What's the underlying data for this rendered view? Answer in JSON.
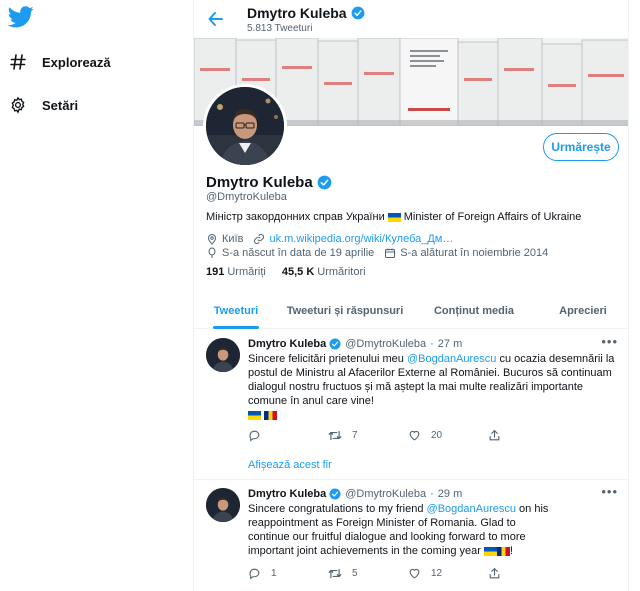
{
  "nav": {
    "logo_icon": "twitter-bird-icon",
    "items": [
      {
        "label": "Explorează",
        "icon": "hashtag-icon"
      },
      {
        "label": "Setări",
        "icon": "gear-icon"
      }
    ]
  },
  "header": {
    "name": "Dmytro Kuleba",
    "tweet_count": "5.813 Tweeturi"
  },
  "profile": {
    "name": "Dmytro Kuleba",
    "handle": "@DmytroKuleba",
    "follow_label": "Urmărește",
    "bio_before": "Міністр закордонних справ України",
    "bio_after": "Minister of Foreign Affairs of Ukraine",
    "location": "Київ",
    "website": "uk.m.wikipedia.org/wiki/Кулеба_Дм…",
    "born": "S-a născut în data de 19 aprilie",
    "joined": "S-a alăturat în noiembrie 2014",
    "following_count": "191",
    "following_label": "Urmăriți",
    "followers_count": "45,5 K",
    "followers_label": "Urmăritori"
  },
  "tabs": [
    {
      "label": "Tweeturi",
      "active": true
    },
    {
      "label": "Tweeturi și răspunsuri",
      "active": false
    },
    {
      "label": "Conținut media",
      "active": false
    },
    {
      "label": "Aprecieri",
      "active": false
    }
  ],
  "tweets": [
    {
      "name": "Dmytro Kuleba",
      "handle": "@DmytroKuleba",
      "time": "27 m",
      "text_1": "Sincere felicitări prietenului meu ",
      "mention": "@BogdanAurescu",
      "text_2": " cu ocazia desemnării  la postul de Ministru al Afacerilor Externe al României. Bucuros să continuam dialogul nostru fructuos și mă aștept la mai multe realizări importante comune în anul care vine!",
      "replies": "",
      "retweets": "7",
      "likes": "20",
      "translate": "Afișează acest fir"
    },
    {
      "name": "Dmytro Kuleba",
      "handle": "@DmytroKuleba",
      "time": "29 m",
      "text_1": "Sincere congratulations to my friend ",
      "mention": "@BogdanAurescu",
      "text_2": " on his reappointment as Foreign Minister of Romania. Glad to continue our fruitful dialogue and looking forward to more important joint achievements in the coming year ",
      "replies": "1",
      "retweets": "5",
      "likes": "12"
    }
  ],
  "colors": {
    "accent": "#1d9bf0",
    "text": "#0f1419",
    "muted": "#536471",
    "verified": "#1d9bf0"
  }
}
